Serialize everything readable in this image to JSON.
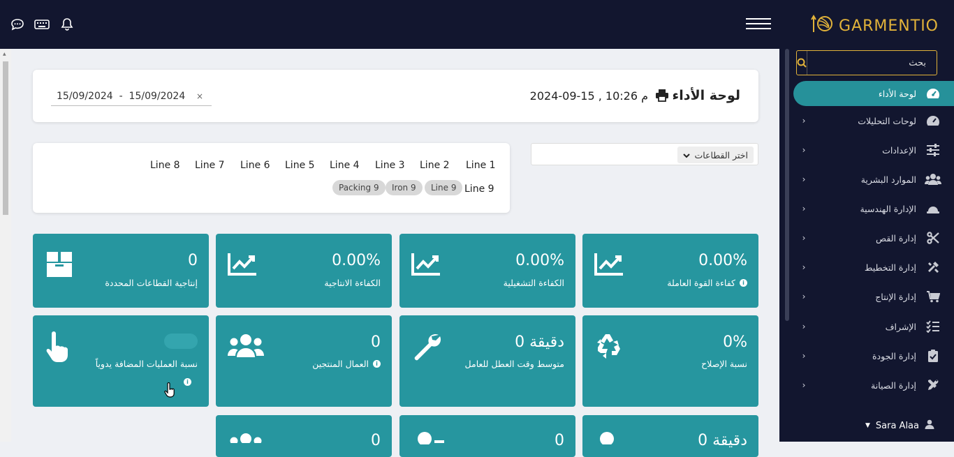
{
  "brand": {
    "name": "GARMENTIO"
  },
  "topbar": {
    "icons": [
      "chat-icon",
      "keyboard-icon",
      "bell-icon"
    ]
  },
  "sidebar": {
    "search_placeholder": "بحث",
    "items": [
      {
        "label": "لوحة الأداء",
        "icon": "dashboard-icon",
        "active": true
      },
      {
        "label": "لوحات التحليلات",
        "icon": "analytics-icon"
      },
      {
        "label": "الإعدادات",
        "icon": "sliders-icon"
      },
      {
        "label": "الموارد البشرية",
        "icon": "users-icon"
      },
      {
        "label": "الإدارة الهندسية",
        "icon": "helmet-icon"
      },
      {
        "label": "إدارة القص",
        "icon": "scissors-icon"
      },
      {
        "label": "إدارة التخطيط",
        "icon": "tools-icon"
      },
      {
        "label": "إدارة الإنتاج",
        "icon": "cart-icon"
      },
      {
        "label": "الإشراف",
        "icon": "checklist-icon"
      },
      {
        "label": "إدارة الجودة",
        "icon": "clipboard-check-icon"
      },
      {
        "label": "إدارة الصيانة",
        "icon": "wrench-screwdriver-icon"
      }
    ],
    "user": "Sara Alaa"
  },
  "header": {
    "title": "لوحة الأداء",
    "datetime": "2024-09-15 , 10:26 م",
    "date_range": "15/09/2024  -  15/09/2024",
    "clear": "×"
  },
  "lines": {
    "row1": [
      "Line 1",
      "Line 2",
      "Line 3",
      "Line 4",
      "Line 5",
      "Line 6",
      "Line 7",
      "Line 8"
    ],
    "row2_label": "Line 9",
    "chips": [
      "Line 9",
      "Iron 9",
      "Packing 9"
    ]
  },
  "sector_select": {
    "label": "اختر القطاعات"
  },
  "stats": [
    {
      "value": "0.00%",
      "label": "كفاءة القوة العاملة",
      "icon": "chart-line-icon",
      "info": true
    },
    {
      "value": "0.00%",
      "label": "الكفاءة التشغيلية",
      "icon": "chart-line-icon",
      "info": false
    },
    {
      "value": "0.00%",
      "label": "الكفاءة الانتاجية",
      "icon": "chart-line-icon",
      "info": false
    },
    {
      "value": "0",
      "label": "إنتاجية القطاعات المحددة",
      "icon": "box-icon",
      "info": false
    },
    {
      "value": "0%",
      "label": "نسبة الإصلاح",
      "icon": "recycle-icon",
      "info": false
    },
    {
      "value": "0 دقيقة",
      "label": "متوسط وقت العطل للعامل",
      "icon": "wrench-icon",
      "info": false
    },
    {
      "value": "0",
      "label": "العمال المنتجين",
      "icon": "users-icon",
      "info": true
    },
    {
      "value": "",
      "label": "نسبة العمليات المضافة يدوياً",
      "icon": "hand-pointer-icon",
      "info": true
    },
    {
      "value": "0 دقيقة",
      "label": "",
      "icon": "user-icon",
      "info": false
    },
    {
      "value": "0",
      "label": "",
      "icon": "user-key-icon",
      "info": false
    },
    {
      "value": "0",
      "label": "",
      "icon": "users-icon",
      "info": false
    }
  ],
  "colors": {
    "topbar": "#12162f",
    "accent": "#26969f",
    "brand": "#e2b33a"
  }
}
